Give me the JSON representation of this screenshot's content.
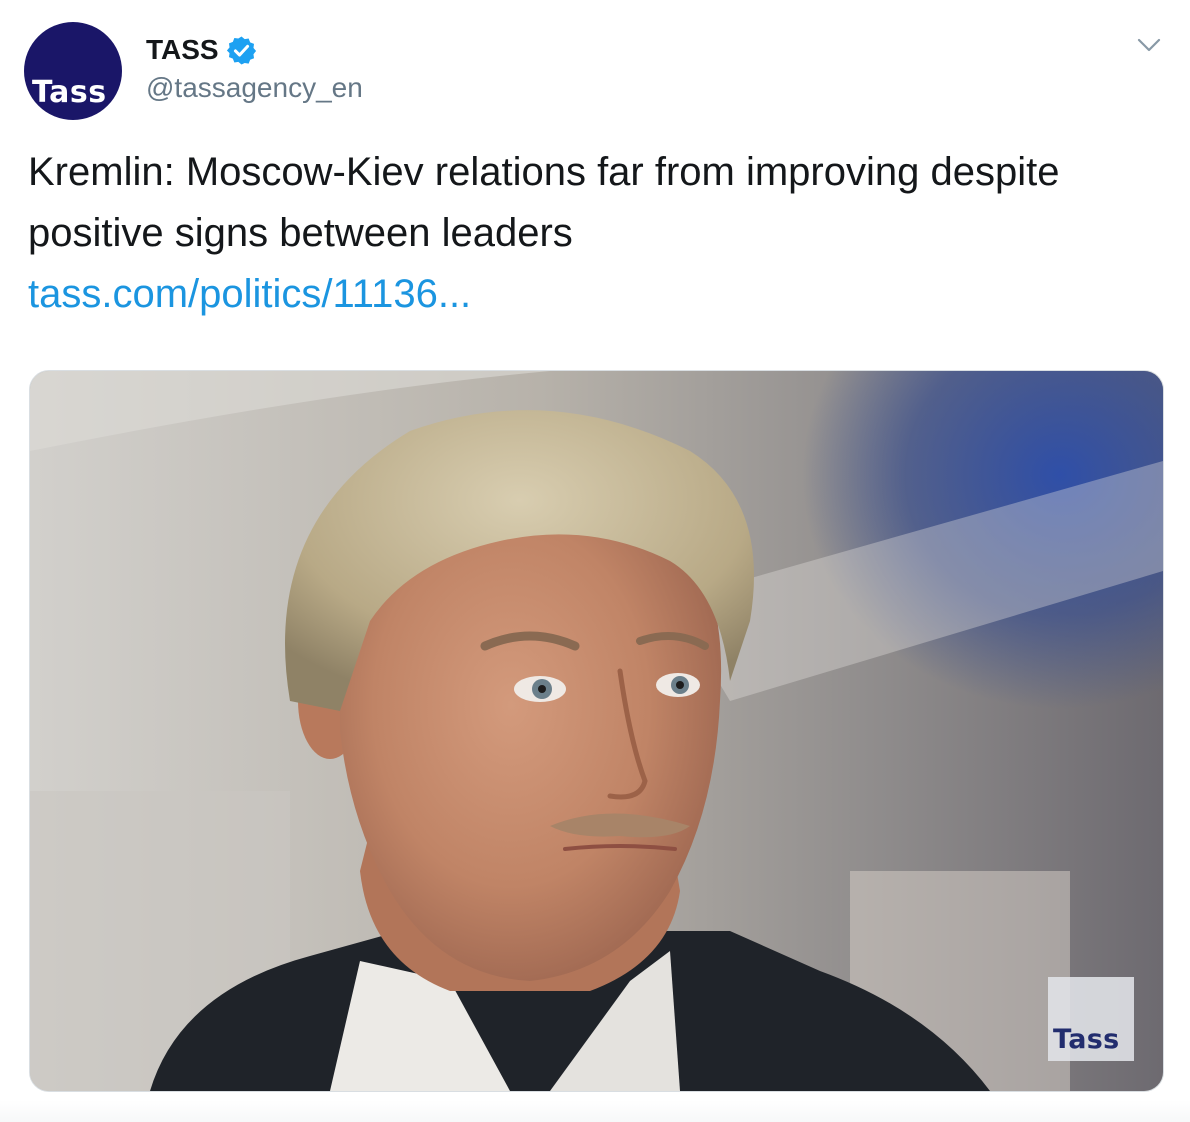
{
  "author": {
    "display_name": "TASS",
    "handle": "@tassagency_en",
    "avatar_logo": "Tass",
    "verified": true,
    "verified_icon": "verified-badge-icon",
    "menu_icon": "chevron-down-icon"
  },
  "tweet": {
    "text": "Kremlin: Moscow-Kiev relations far from improving despite positive signs between leaders",
    "link": "tass.com/politics/11136..."
  },
  "media": {
    "watermark": "Tass"
  },
  "colors": {
    "link": "#1b95e0",
    "verified": "#1da1f2",
    "avatar_bg": "#1a1668",
    "secondary_text": "#657786"
  }
}
